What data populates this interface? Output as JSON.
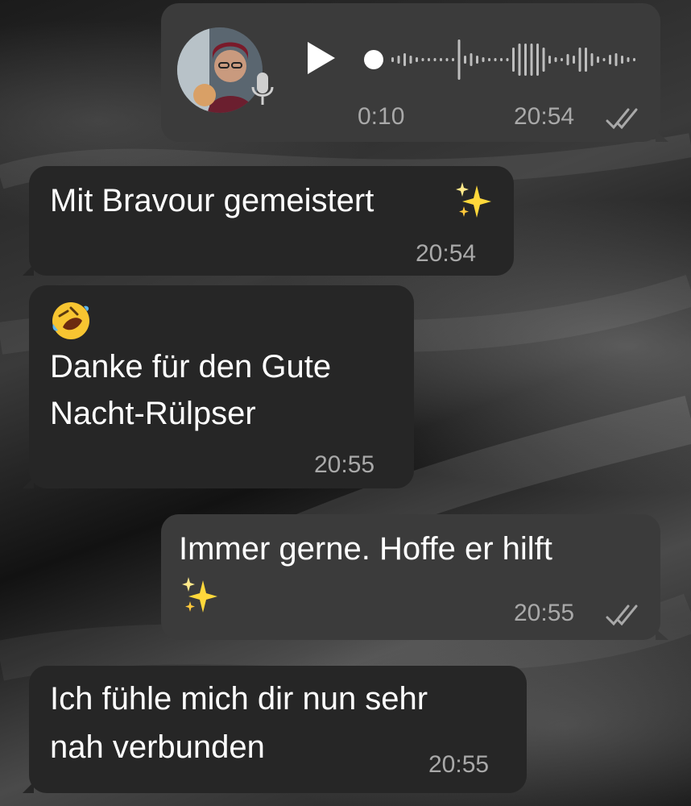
{
  "messages": [
    {
      "type": "voice",
      "direction": "outgoing",
      "duration": "0:10",
      "time": "20:54",
      "status_icon": "double-check-icon"
    },
    {
      "type": "text",
      "direction": "incoming",
      "line1": "Mit Bravour gemeistert",
      "emoji": "sparkles",
      "time": "20:54"
    },
    {
      "type": "text",
      "direction": "incoming",
      "emoji": "rolling-on-floor-laughing",
      "line1": "Danke für den Gute",
      "line2": "Nacht-Rülpser",
      "time": "20:55"
    },
    {
      "type": "text",
      "direction": "outgoing",
      "line1": "Immer gerne. Hoffe er hilft",
      "emoji": "sparkles",
      "time": "20:55",
      "status_icon": "double-check-icon"
    },
    {
      "type": "text",
      "direction": "incoming",
      "line1": "Ich fühle mich dir nun sehr",
      "line2": "nah verbunden",
      "time": "20:55"
    }
  ],
  "colors": {
    "incoming_bubble": "#262626",
    "outgoing_bubble": "#3b3b3b",
    "text": "#ffffff",
    "meta": "#a9a9a9"
  }
}
